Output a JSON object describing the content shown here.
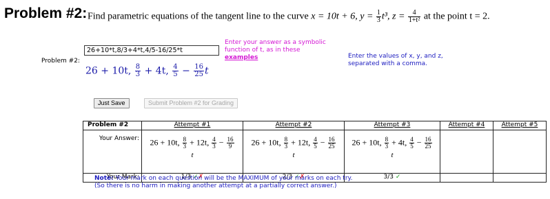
{
  "header": {
    "title": "Problem #2:",
    "q_intro": "Find parametric equations of the tangent line to the curve",
    "q_x": "x = 10t + 6,",
    "q_y_pre": "y =",
    "q_y_num": "1",
    "q_y_den": "3",
    "q_y_post": "t³,",
    "q_z_pre": "z =",
    "q_z_num": "4",
    "q_z_den": "1+t²",
    "q_tail": "at the point  t = 2."
  },
  "answer": {
    "problem_label": "Problem #2:",
    "input_value": "26+10*t,8/3+4*t,4/5-16/25*t",
    "hint_line1": "Enter your answer as a symbolic",
    "hint_line2": "function of t, as in these",
    "hint_link": "examples",
    "explain_line1": "Enter the values of x, y, and z,",
    "explain_line2": "separated with a comma.",
    "preview": {
      "a": "26 + 10t,",
      "b_num": "8",
      "b_den": "3",
      "b_tail": "+ 4t,",
      "c_num": "4",
      "c_den": "5",
      "c_mid": "−",
      "c2_num": "16",
      "c2_den": "25",
      "c2_tail": "t"
    }
  },
  "buttons": {
    "save": "Just Save",
    "submit": "Submit Problem #2 for Grading"
  },
  "table": {
    "corner": "Problem #2",
    "row_answer_label": "Your Answer:",
    "row_mark_label": "Your Mark:",
    "attempts": [
      {
        "header": "Attempt #1",
        "a": "26 + 10t,",
        "bn": "8",
        "bd": "3",
        "bt": "+ 12t,",
        "cn": "4",
        "cd": "3",
        "dn": "16",
        "dd": "9",
        "t": "t",
        "mark": "1/3",
        "m1": "✓",
        "m2": "✗"
      },
      {
        "header": "Attempt #2",
        "a": "26 + 10t,",
        "bn": "8",
        "bd": "3",
        "bt": "+ 12t,",
        "cn": "4",
        "cd": "5",
        "dn": "16",
        "dd": "25",
        "t": "t",
        "mark": "2/3",
        "m1": "✓",
        "m2": "✗"
      },
      {
        "header": "Attempt #3",
        "a": "26 + 10t,",
        "bn": "8",
        "bd": "3",
        "bt": "+ 4t,",
        "cn": "4",
        "cd": "5",
        "dn": "16",
        "dd": "25",
        "t": "t",
        "mark": "3/3",
        "m1": "✓",
        "m2": ""
      },
      {
        "header": "Attempt #4"
      },
      {
        "header": "Attempt #5"
      }
    ],
    "minus": "−"
  },
  "note": {
    "bold": "Note:",
    "line1": " Your mark on each question will be the MAXIMUM of your marks on each try.",
    "line2": "(So there is no harm in making another attempt at a partially correct answer.)"
  }
}
